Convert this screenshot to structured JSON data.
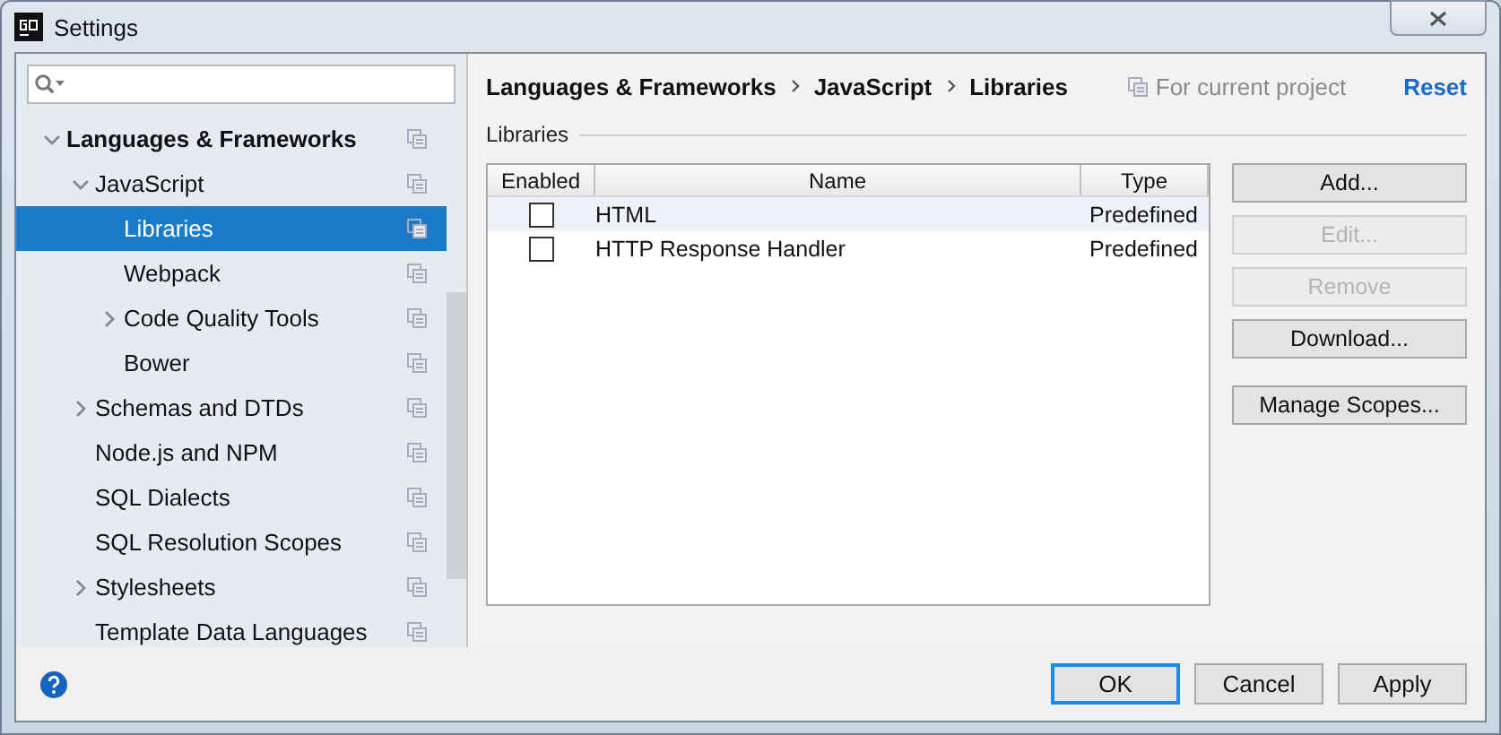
{
  "window": {
    "title": "Settings"
  },
  "tree": [
    {
      "label": "Languages & Frameworks",
      "expanded": true,
      "selected": false,
      "children": [
        {
          "label": "JavaScript",
          "expanded": true,
          "selected": false,
          "children": [
            {
              "label": "Libraries",
              "selected": true
            },
            {
              "label": "Webpack",
              "selected": false
            },
            {
              "label": "Code Quality Tools",
              "expanded": false,
              "selected": false
            },
            {
              "label": "Bower",
              "selected": false
            }
          ]
        },
        {
          "label": "Schemas and DTDs",
          "expanded": false,
          "selected": false
        },
        {
          "label": "Node.js and NPM",
          "selected": false
        },
        {
          "label": "SQL Dialects",
          "selected": false
        },
        {
          "label": "SQL Resolution Scopes",
          "selected": false
        },
        {
          "label": "Stylesheets",
          "expanded": false,
          "selected": false
        },
        {
          "label": "Template Data Languages",
          "selected": false
        }
      ]
    }
  ],
  "breadcrumb": [
    "Languages & Frameworks",
    "JavaScript",
    "Libraries"
  ],
  "scope_note": "For current project",
  "reset_link": "Reset",
  "section_title": "Libraries",
  "table": {
    "columns": [
      "Enabled",
      "Name",
      "Type"
    ],
    "rows": [
      {
        "enabled": false,
        "name": "HTML",
        "type": "Predefined",
        "selected": true
      },
      {
        "enabled": false,
        "name": "HTTP Response Handler",
        "type": "Predefined",
        "selected": false
      }
    ]
  },
  "button_groups": [
    [
      {
        "label": "Add...",
        "disabled": false
      },
      {
        "label": "Edit...",
        "disabled": true
      },
      {
        "label": "Remove",
        "disabled": true
      },
      {
        "label": "Download...",
        "disabled": false
      }
    ],
    [
      {
        "label": "Manage Scopes...",
        "disabled": false
      }
    ]
  ],
  "footer_buttons": [
    {
      "label": "OK",
      "default": true
    },
    {
      "label": "Cancel",
      "default": false
    },
    {
      "label": "Apply",
      "default": false
    }
  ]
}
